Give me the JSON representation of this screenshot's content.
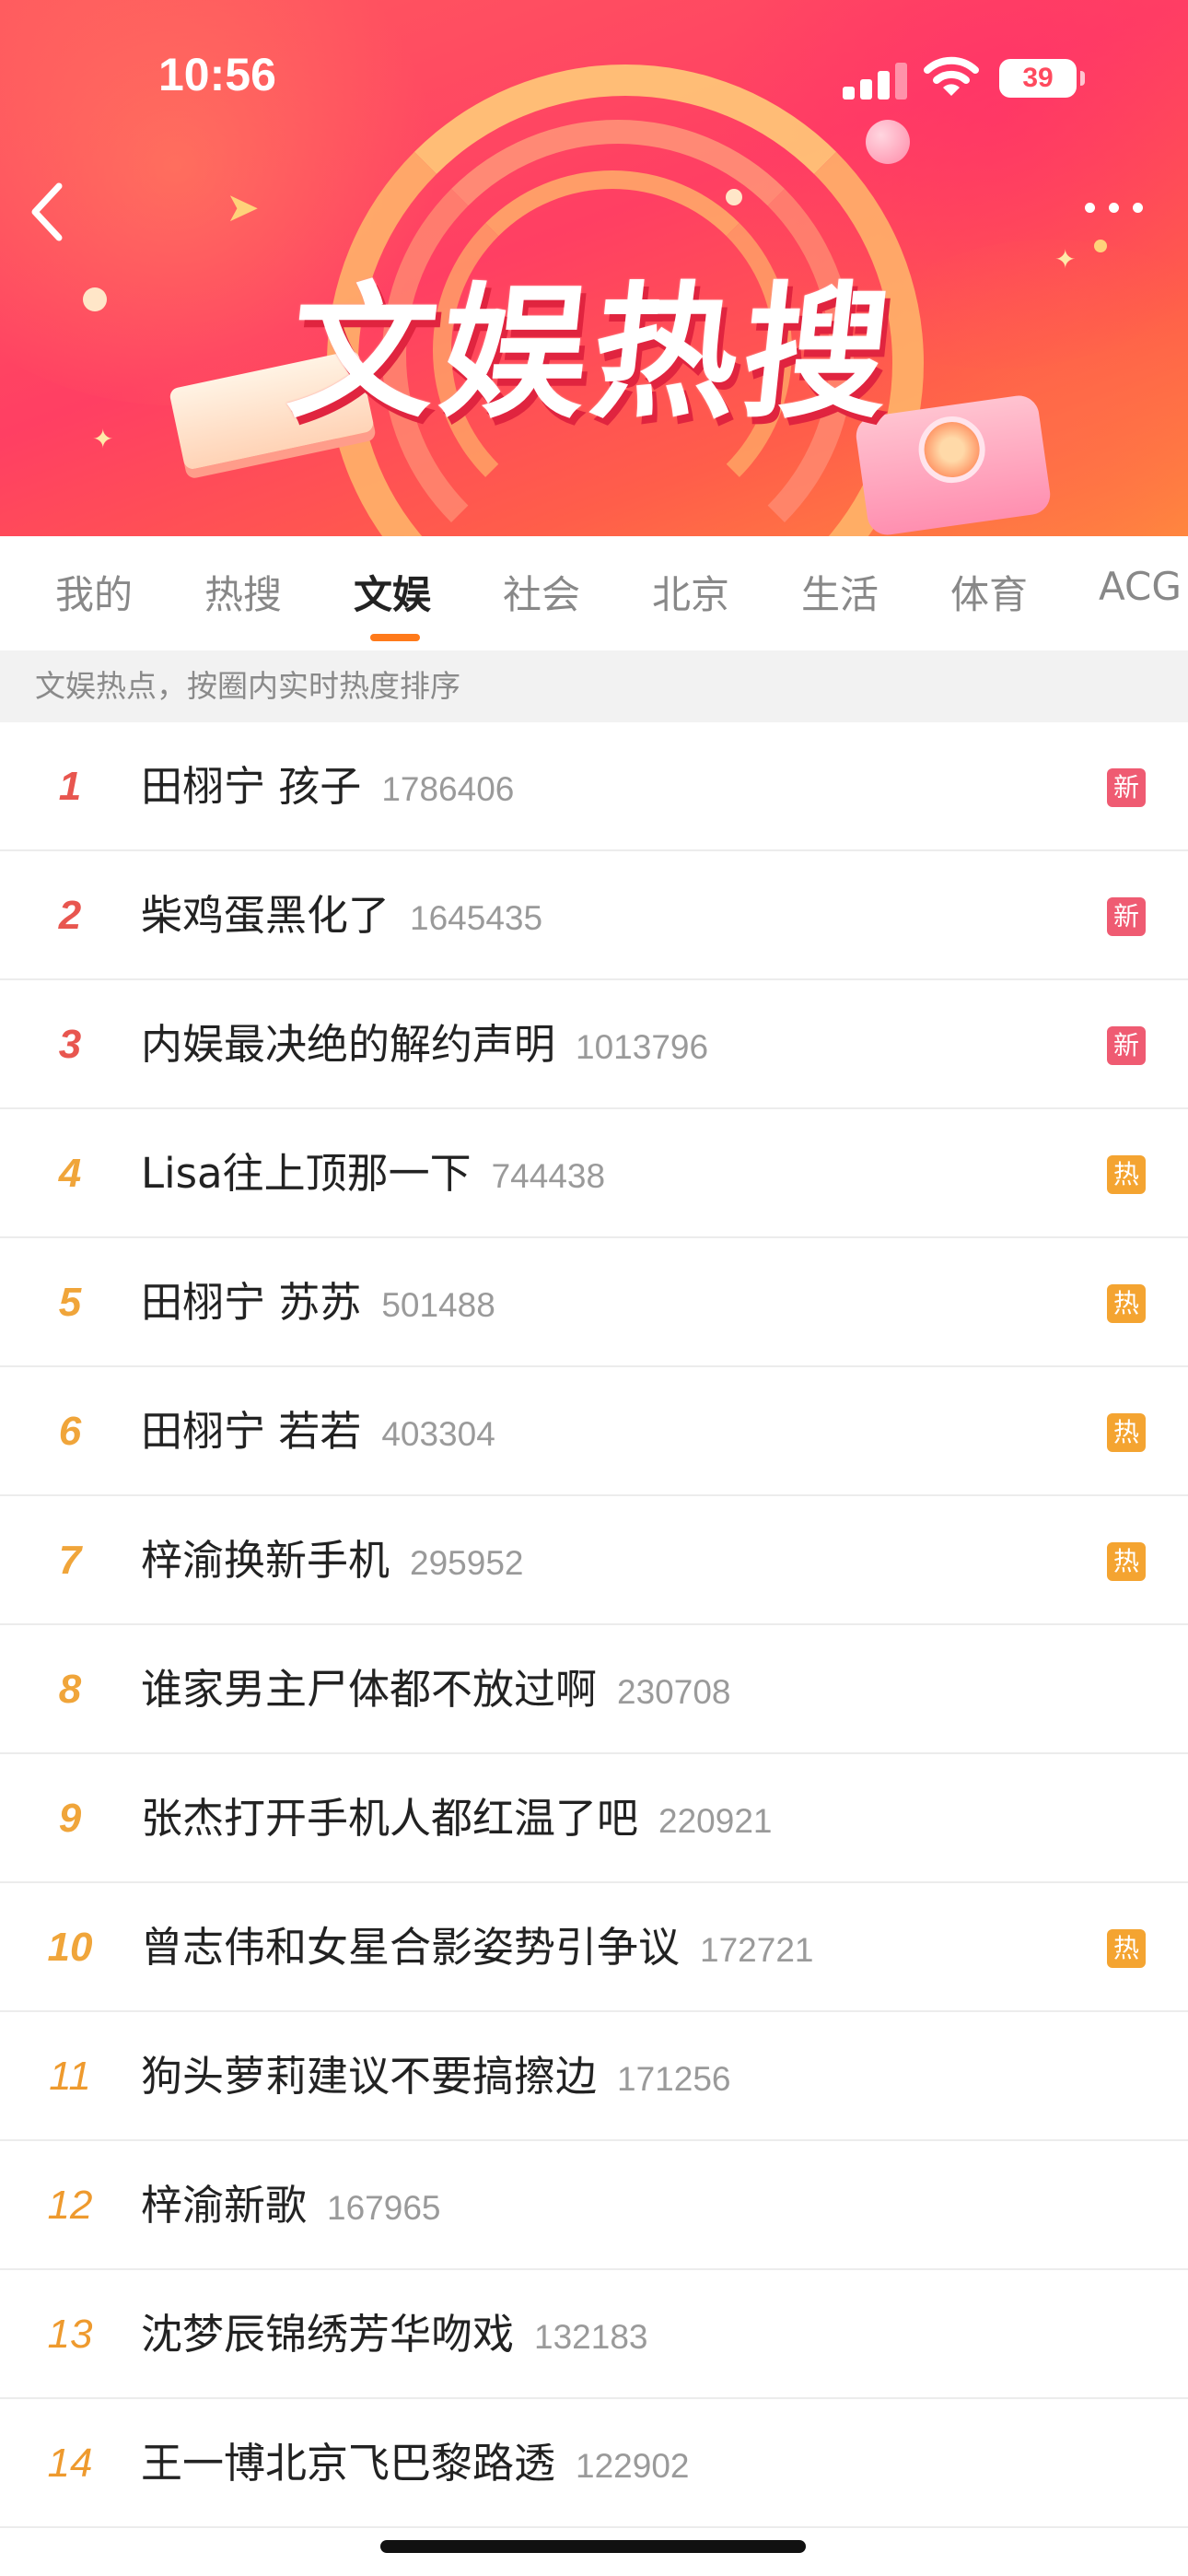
{
  "status_bar": {
    "time": "10:56",
    "battery": "39",
    "signal_icon": "cellular-signal-icon",
    "wifi_icon": "wifi-icon"
  },
  "header": {
    "title": "文娱热搜",
    "back_icon": "chevron-left-icon",
    "more_icon": "more-dots-icon",
    "colors": {
      "banner_start": "#ff5a5f",
      "banner_end": "#ff8a3d"
    }
  },
  "tabs": [
    {
      "label": "我的",
      "active": false
    },
    {
      "label": "热搜",
      "active": false
    },
    {
      "label": "文娱",
      "active": true
    },
    {
      "label": "社会",
      "active": false
    },
    {
      "label": "北京",
      "active": false
    },
    {
      "label": "生活",
      "active": false
    },
    {
      "label": "体育",
      "active": false
    },
    {
      "label": "ACG",
      "active": false
    }
  ],
  "notice": "文娱热点，按圈内实时热度排序",
  "colors": {
    "accent": "#ff7a1a",
    "new_badge": "#ef5b72",
    "hot_badge": "#f4a431",
    "top_rank": "#e8564f",
    "rank": "#f0a53a"
  },
  "list": [
    {
      "rank": "1",
      "title": "田栩宁 孩子",
      "count": "1786406",
      "badge": "新",
      "badge_type": "new"
    },
    {
      "rank": "2",
      "title": "柴鸡蛋黑化了",
      "count": "1645435",
      "badge": "新",
      "badge_type": "new"
    },
    {
      "rank": "3",
      "title": "内娱最决绝的解约声明",
      "count": "1013796",
      "badge": "新",
      "badge_type": "new"
    },
    {
      "rank": "4",
      "title": "Lisa往上顶那一下",
      "count": "744438",
      "badge": "热",
      "badge_type": "hot"
    },
    {
      "rank": "5",
      "title": "田栩宁 苏苏",
      "count": "501488",
      "badge": "热",
      "badge_type": "hot"
    },
    {
      "rank": "6",
      "title": "田栩宁 若若",
      "count": "403304",
      "badge": "热",
      "badge_type": "hot"
    },
    {
      "rank": "7",
      "title": "梓渝换新手机",
      "count": "295952",
      "badge": "热",
      "badge_type": "hot"
    },
    {
      "rank": "8",
      "title": "谁家男主尸体都不放过啊",
      "count": "230708",
      "badge": "",
      "badge_type": ""
    },
    {
      "rank": "9",
      "title": "张杰打开手机人都红温了吧",
      "count": "220921",
      "badge": "",
      "badge_type": ""
    },
    {
      "rank": "10",
      "title": "曾志伟和女星合影姿势引争议",
      "count": "172721",
      "badge": "热",
      "badge_type": "hot"
    },
    {
      "rank": "11",
      "title": "狗头萝莉建议不要搞擦边",
      "count": "171256",
      "badge": "",
      "badge_type": ""
    },
    {
      "rank": "12",
      "title": "梓渝新歌",
      "count": "167965",
      "badge": "",
      "badge_type": ""
    },
    {
      "rank": "13",
      "title": "沈梦辰锦绣芳华吻戏",
      "count": "132183",
      "badge": "",
      "badge_type": ""
    },
    {
      "rank": "14",
      "title": "王一博北京飞巴黎路透",
      "count": "122902",
      "badge": "",
      "badge_type": ""
    }
  ]
}
